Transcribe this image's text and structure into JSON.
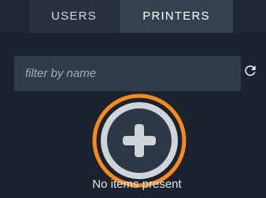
{
  "tabs": [
    {
      "label": "USERS",
      "active": false
    },
    {
      "label": "PRINTERS",
      "active": true
    }
  ],
  "filter": {
    "placeholder": "filter by name",
    "value": ""
  },
  "icons": {
    "refresh": "refresh-icon",
    "add": "add-circle-icon"
  },
  "empty_state": {
    "message": "No items present"
  },
  "colors": {
    "background": "#1a232d",
    "active_tab": "#34414e",
    "inactive_tab": "#27323d",
    "input_bg": "#2f3d4b",
    "highlight_ring": "#f7891f",
    "icon": "#cfd4d8"
  }
}
